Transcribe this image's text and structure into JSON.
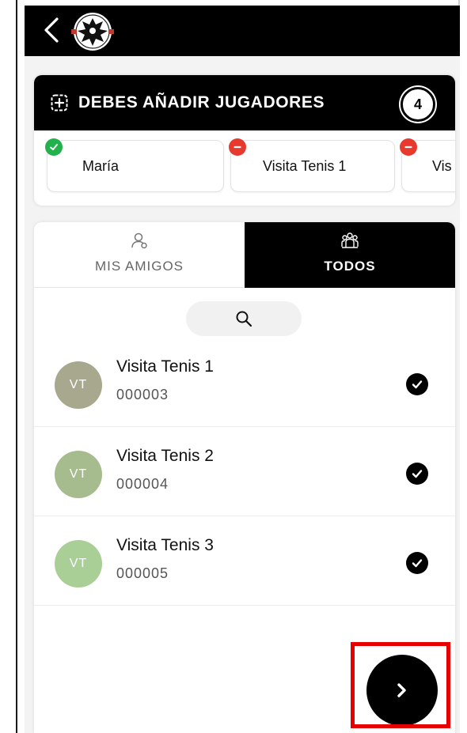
{
  "players": {
    "title": "DEBES AÑADIR JUGADORES",
    "count": "4",
    "chips": [
      {
        "name": "María",
        "status": "added"
      },
      {
        "name": "Visita Tenis 1",
        "status": "removable"
      },
      {
        "name": "Vis",
        "status": "removable"
      }
    ]
  },
  "tabs": {
    "friends_label": "MIS AMIGOS",
    "all_label": "TODOS",
    "active": "all"
  },
  "members": [
    {
      "initials": "VT",
      "name": "Visita Tenis 1",
      "code": "000003",
      "avatar_color": "#a8a88f",
      "selected": true
    },
    {
      "initials": "VT",
      "name": "Visita Tenis 2",
      "code": "000004",
      "avatar_color": "#a6bc8e",
      "selected": true
    },
    {
      "initials": "VT",
      "name": "Visita Tenis 3",
      "code": "000005",
      "avatar_color": "#a9cf97",
      "selected": true
    }
  ],
  "colors": {
    "header_bg": "#000000",
    "added_status": "#22b14c",
    "remove_status": "#e8392f",
    "highlight": "#e60000"
  },
  "icons": {
    "back": "chevron-left-icon",
    "add_players": "add-square-icon",
    "friends_tab": "person-outline-icon",
    "all_tab": "group-icon",
    "search": "search-icon",
    "selected": "check-circle-icon",
    "next": "chevron-right-icon"
  }
}
